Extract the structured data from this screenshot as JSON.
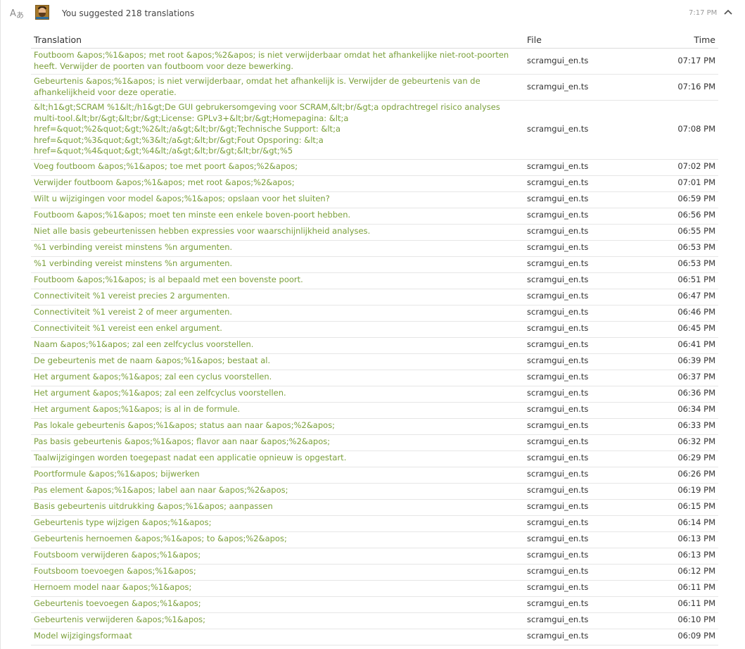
{
  "header": {
    "summary": "You suggested 218 translations",
    "time": "7:17 PM",
    "icons": {
      "translate": "translate-icon",
      "collapse": "chevron-up-icon"
    }
  },
  "colors": {
    "link": "#7a9f3a",
    "text": "#333333",
    "muted": "#999999",
    "rule": "#e6e6e6"
  },
  "table": {
    "columns": {
      "translation": "Translation",
      "file": "File",
      "time": "Time"
    },
    "rows": [
      {
        "translation": "Foutboom &apos;%1&apos; met root &apos;%2&apos; is niet verwijderbaar omdat het afhankelijke niet-root-poorten heeft. Verwijder de poorten van foutboom voor deze bewerking.",
        "file": "scramgui_en.ts",
        "time": "07:17 PM"
      },
      {
        "translation": "Gebeurtenis &apos;%1&apos; is niet verwijderbaar, omdat het afhankelijk is. Verwijder de gebeurtenis van de afhankelijkheid voor deze operatie.",
        "file": "scramgui_en.ts",
        "time": "07:16 PM"
      },
      {
        "translation": "&lt;h1&gt;SCRAM %1&lt;/h1&gt;De GUI gebrukersomgeving voor SCRAM,&lt;br/&gt;a opdrachtregel risico analyses multi-tool.&lt;br/&gt;&lt;br/&gt;License: GPLv3+&lt;br/&gt;Homepagina: &lt;a href=&quot;%2&quot;&gt;%2&lt;/a&gt;&lt;br/&gt;Technische Support: &lt;a href=&quot;%3&quot;&gt;%3&lt;/a&gt;&lt;br/&gt;Fout Opsporing: &lt;a href=&quot;%4&quot;&gt;%4&lt;/a&gt;&lt;br/&gt;&lt;br/&gt;%5",
        "file": "scramgui_en.ts",
        "time": "07:08 PM"
      },
      {
        "translation": "Voeg foutboom &apos;%1&apos; toe met poort &apos;%2&apos;",
        "file": "scramgui_en.ts",
        "time": "07:02 PM"
      },
      {
        "translation": "Verwijder foutboom &apos;%1&apos; met root &apos;%2&apos;",
        "file": "scramgui_en.ts",
        "time": "07:01 PM"
      },
      {
        "translation": "Wilt u wijzigingen voor model &apos;%1&apos; opslaan voor het sluiten?",
        "file": "scramgui_en.ts",
        "time": "06:59 PM"
      },
      {
        "translation": "Foutboom &apos;%1&apos; moet ten minste een enkele boven-poort hebben.",
        "file": "scramgui_en.ts",
        "time": "06:56 PM"
      },
      {
        "translation": "Niet alle basis gebeurtenissen hebben expressies voor waarschijnlijkheid analyses.",
        "file": "scramgui_en.ts",
        "time": "06:55 PM"
      },
      {
        "translation": "%1 verbinding vereist minstens %n argumenten.",
        "file": "scramgui_en.ts",
        "time": "06:53 PM"
      },
      {
        "translation": "%1 verbinding vereist minstens %n argumenten.",
        "file": "scramgui_en.ts",
        "time": "06:53 PM"
      },
      {
        "translation": "Foutboom &apos;%1&apos; is al bepaald met een bovenste poort.",
        "file": "scramgui_en.ts",
        "time": "06:51 PM"
      },
      {
        "translation": "Connectiviteit %1 vereist precies 2 argumenten.",
        "file": "scramgui_en.ts",
        "time": "06:47 PM"
      },
      {
        "translation": "Connectiviteit %1 vereist 2 of meer argumenten.",
        "file": "scramgui_en.ts",
        "time": "06:46 PM"
      },
      {
        "translation": "Connectiviteit %1 vereist een enkel argument.",
        "file": "scramgui_en.ts",
        "time": "06:45 PM"
      },
      {
        "translation": "Naam &apos;%1&apos; zal een zelfcyclus voorstellen.",
        "file": "scramgui_en.ts",
        "time": "06:41 PM"
      },
      {
        "translation": "De gebeurtenis met de naam &apos;%1&apos; bestaat al.",
        "file": "scramgui_en.ts",
        "time": "06:39 PM"
      },
      {
        "translation": "Het argument &apos;%1&apos; zal een cyclus voorstellen.",
        "file": "scramgui_en.ts",
        "time": "06:37 PM"
      },
      {
        "translation": "Het argument &apos;%1&apos; zal een zelfcyclus voorstellen.",
        "file": "scramgui_en.ts",
        "time": "06:36 PM"
      },
      {
        "translation": "Het argument &apos;%1&apos; is al in de formule.",
        "file": "scramgui_en.ts",
        "time": "06:34 PM"
      },
      {
        "translation": "Pas lokale gebeurtenis &apos;%1&apos; status aan naar &apos;%2&apos;",
        "file": "scramgui_en.ts",
        "time": "06:33 PM"
      },
      {
        "translation": "Pas basis gebeurtenis &apos;%1&apos; flavor aan naar &apos;%2&apos;",
        "file": "scramgui_en.ts",
        "time": "06:32 PM"
      },
      {
        "translation": "Taalwijzigingen worden toegepast nadat een applicatie opnieuw is opgestart.",
        "file": "scramgui_en.ts",
        "time": "06:29 PM"
      },
      {
        "translation": "Poortformule &apos;%1&apos; bijwerken",
        "file": "scramgui_en.ts",
        "time": "06:26 PM"
      },
      {
        "translation": "Pas element &apos;%1&apos; label aan naar &apos;%2&apos;",
        "file": "scramgui_en.ts",
        "time": "06:19 PM"
      },
      {
        "translation": "Basis gebeurtenis uitdrukking &apos;%1&apos; aanpassen",
        "file": "scramgui_en.ts",
        "time": "06:15 PM"
      },
      {
        "translation": "Gebeurtenis type wijzigen &apos;%1&apos;",
        "file": "scramgui_en.ts",
        "time": "06:14 PM"
      },
      {
        "translation": "Gebeurtenis hernoemen &apos;%1&apos; to &apos;%2&apos;",
        "file": "scramgui_en.ts",
        "time": "06:13 PM"
      },
      {
        "translation": "Foutsboom verwijderen &apos;%1&apos;",
        "file": "scramgui_en.ts",
        "time": "06:13 PM"
      },
      {
        "translation": "Foutsboom toevoegen &apos;%1&apos;",
        "file": "scramgui_en.ts",
        "time": "06:12 PM"
      },
      {
        "translation": "Hernoem model naar &apos;%1&apos;",
        "file": "scramgui_en.ts",
        "time": "06:11 PM"
      },
      {
        "translation": "Gebeurtenis toevoegen &apos;%1&apos;",
        "file": "scramgui_en.ts",
        "time": "06:11 PM"
      },
      {
        "translation": "Gebeurtenis verwijderen &apos;%1&apos;",
        "file": "scramgui_en.ts",
        "time": "06:10 PM"
      },
      {
        "translation": "Model wijzigingsformaat",
        "file": "scramgui_en.ts",
        "time": "06:09 PM"
      }
    ]
  }
}
